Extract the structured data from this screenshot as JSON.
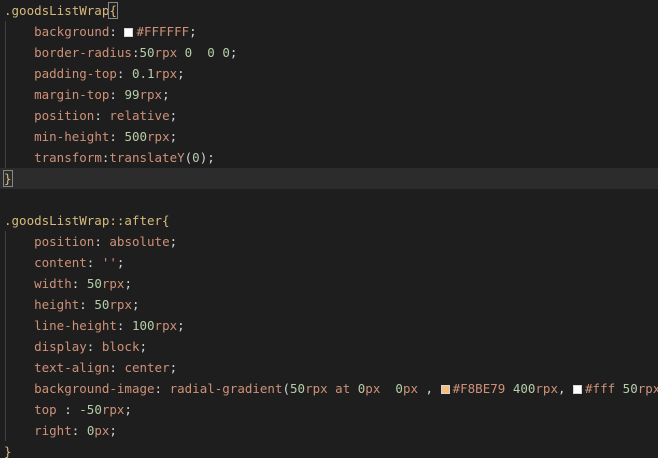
{
  "lines": [
    {
      "kind": "text",
      "parts": [
        {
          "t": ".goodsListWrap",
          "c": "sel"
        },
        {
          "t": "{",
          "c": "brace"
        }
      ]
    },
    {
      "kind": "text",
      "parts": [
        {
          "t": "    "
        },
        {
          "t": "background",
          "c": "prop"
        },
        {
          "t": ": ",
          "c": "punc"
        },
        {
          "swatch": "#FFFFFF"
        },
        {
          "t": "#FFFFFF",
          "c": "hex"
        },
        {
          "t": ";",
          "c": "punc"
        }
      ]
    },
    {
      "kind": "text",
      "parts": [
        {
          "t": "    "
        },
        {
          "t": "border-radius",
          "c": "prop"
        },
        {
          "t": ":",
          "c": "punc"
        },
        {
          "t": "50",
          "c": "num"
        },
        {
          "t": "rpx",
          "c": "unit"
        },
        {
          "t": " ",
          "c": "punc"
        },
        {
          "t": "0",
          "c": "num"
        },
        {
          "t": "  ",
          "c": "punc"
        },
        {
          "t": "0",
          "c": "num"
        },
        {
          "t": " ",
          "c": "punc"
        },
        {
          "t": "0",
          "c": "num"
        },
        {
          "t": ";",
          "c": "punc"
        }
      ]
    },
    {
      "kind": "text",
      "parts": [
        {
          "t": "    "
        },
        {
          "t": "padding-top",
          "c": "prop"
        },
        {
          "t": ": ",
          "c": "punc"
        },
        {
          "t": "0.1",
          "c": "num"
        },
        {
          "t": "rpx",
          "c": "unit"
        },
        {
          "t": ";",
          "c": "punc"
        }
      ]
    },
    {
      "kind": "text",
      "parts": [
        {
          "t": "    "
        },
        {
          "t": "margin-top",
          "c": "prop"
        },
        {
          "t": ": ",
          "c": "punc"
        },
        {
          "t": "99",
          "c": "num"
        },
        {
          "t": "rpx",
          "c": "unit"
        },
        {
          "t": ";",
          "c": "punc"
        }
      ]
    },
    {
      "kind": "text",
      "parts": [
        {
          "t": "    "
        },
        {
          "t": "position",
          "c": "prop"
        },
        {
          "t": ": ",
          "c": "punc"
        },
        {
          "t": "relative",
          "c": "val"
        },
        {
          "t": ";",
          "c": "punc"
        }
      ]
    },
    {
      "kind": "text",
      "parts": [
        {
          "t": "    "
        },
        {
          "t": "min-height",
          "c": "prop"
        },
        {
          "t": ": ",
          "c": "punc"
        },
        {
          "t": "500",
          "c": "num"
        },
        {
          "t": "rpx",
          "c": "unit"
        },
        {
          "t": ";",
          "c": "punc"
        }
      ]
    },
    {
      "kind": "text",
      "parts": [
        {
          "t": "    "
        },
        {
          "t": "transform",
          "c": "prop"
        },
        {
          "t": ":",
          "c": "punc"
        },
        {
          "t": "translateY",
          "c": "val"
        },
        {
          "t": "(",
          "c": "punc"
        },
        {
          "t": "0",
          "c": "num"
        },
        {
          "t": ");",
          "c": "punc"
        }
      ]
    },
    {
      "kind": "text",
      "current": true,
      "parts": [
        {
          "t": "}",
          "c": "brace"
        }
      ]
    },
    {
      "kind": "text",
      "parts": []
    },
    {
      "kind": "text",
      "parts": [
        {
          "t": ".goodsListWrap::after",
          "c": "sel"
        },
        {
          "t": "{",
          "c": "sel"
        }
      ]
    },
    {
      "kind": "text",
      "parts": [
        {
          "t": "    "
        },
        {
          "t": "position",
          "c": "prop"
        },
        {
          "t": ": ",
          "c": "punc"
        },
        {
          "t": "absolute",
          "c": "val"
        },
        {
          "t": ";",
          "c": "punc"
        }
      ]
    },
    {
      "kind": "text",
      "parts": [
        {
          "t": "    "
        },
        {
          "t": "content",
          "c": "prop"
        },
        {
          "t": ": ",
          "c": "punc"
        },
        {
          "t": "''",
          "c": "val"
        },
        {
          "t": ";",
          "c": "punc"
        }
      ]
    },
    {
      "kind": "text",
      "parts": [
        {
          "t": "    "
        },
        {
          "t": "width",
          "c": "prop"
        },
        {
          "t": ": ",
          "c": "punc"
        },
        {
          "t": "50",
          "c": "num"
        },
        {
          "t": "rpx",
          "c": "unit"
        },
        {
          "t": ";",
          "c": "punc"
        }
      ]
    },
    {
      "kind": "text",
      "parts": [
        {
          "t": "    "
        },
        {
          "t": "height",
          "c": "prop"
        },
        {
          "t": ": ",
          "c": "punc"
        },
        {
          "t": "50",
          "c": "num"
        },
        {
          "t": "rpx",
          "c": "unit"
        },
        {
          "t": ";",
          "c": "punc"
        }
      ]
    },
    {
      "kind": "text",
      "parts": [
        {
          "t": "    "
        },
        {
          "t": "line-height",
          "c": "prop"
        },
        {
          "t": ": ",
          "c": "punc"
        },
        {
          "t": "100",
          "c": "num"
        },
        {
          "t": "rpx",
          "c": "unit"
        },
        {
          "t": ";",
          "c": "punc"
        }
      ]
    },
    {
      "kind": "text",
      "parts": [
        {
          "t": "    "
        },
        {
          "t": "display",
          "c": "prop"
        },
        {
          "t": ": ",
          "c": "punc"
        },
        {
          "t": "block",
          "c": "val"
        },
        {
          "t": ";",
          "c": "punc"
        }
      ]
    },
    {
      "kind": "text",
      "parts": [
        {
          "t": "    "
        },
        {
          "t": "text-align",
          "c": "prop"
        },
        {
          "t": ": ",
          "c": "punc"
        },
        {
          "t": "center",
          "c": "val"
        },
        {
          "t": ";",
          "c": "punc"
        }
      ]
    },
    {
      "kind": "text",
      "parts": [
        {
          "t": "    "
        },
        {
          "t": "background-image",
          "c": "prop"
        },
        {
          "t": ": ",
          "c": "punc"
        },
        {
          "t": "radial-gradient",
          "c": "val"
        },
        {
          "t": "(",
          "c": "punc"
        },
        {
          "t": "50",
          "c": "num"
        },
        {
          "t": "rpx",
          "c": "unit"
        },
        {
          "t": " at ",
          "c": "val"
        },
        {
          "t": "0",
          "c": "num"
        },
        {
          "t": "px",
          "c": "unit"
        },
        {
          "t": "  ",
          "c": "punc"
        },
        {
          "t": "0",
          "c": "num"
        },
        {
          "t": "px",
          "c": "unit"
        },
        {
          "t": " , ",
          "c": "punc"
        },
        {
          "swatch": "#F8BE79"
        },
        {
          "t": "#F8BE79",
          "c": "hex"
        },
        {
          "t": " ",
          "c": "punc"
        },
        {
          "t": "400",
          "c": "num"
        },
        {
          "t": "rpx",
          "c": "unit"
        },
        {
          "t": ", ",
          "c": "punc"
        },
        {
          "swatch": "#fff"
        },
        {
          "t": "#fff",
          "c": "hex"
        },
        {
          "t": " ",
          "c": "punc"
        },
        {
          "t": "50",
          "c": "num"
        },
        {
          "t": "rpx",
          "c": "unit"
        },
        {
          "t": ");",
          "c": "punc"
        }
      ]
    },
    {
      "kind": "text",
      "parts": [
        {
          "t": "    "
        },
        {
          "t": "top",
          "c": "prop"
        },
        {
          "t": " : ",
          "c": "punc"
        },
        {
          "t": "-50",
          "c": "num"
        },
        {
          "t": "rpx",
          "c": "unit"
        },
        {
          "t": ";",
          "c": "punc"
        }
      ]
    },
    {
      "kind": "text",
      "parts": [
        {
          "t": "    "
        },
        {
          "t": "right",
          "c": "prop"
        },
        {
          "t": ": ",
          "c": "punc"
        },
        {
          "t": "0",
          "c": "num"
        },
        {
          "t": "px",
          "c": "unit"
        },
        {
          "t": ";",
          "c": "punc"
        }
      ]
    },
    {
      "kind": "text",
      "parts": [
        {
          "t": "}",
          "c": "sel"
        }
      ]
    }
  ],
  "colors": {
    "editor_bg": "#1e1e1e",
    "current_line_bg": "#2c2c2c",
    "selector": "#d7ba7d",
    "property": "#ce9178",
    "number": "#b5cea8",
    "punctuation": "#d4d4d4"
  }
}
